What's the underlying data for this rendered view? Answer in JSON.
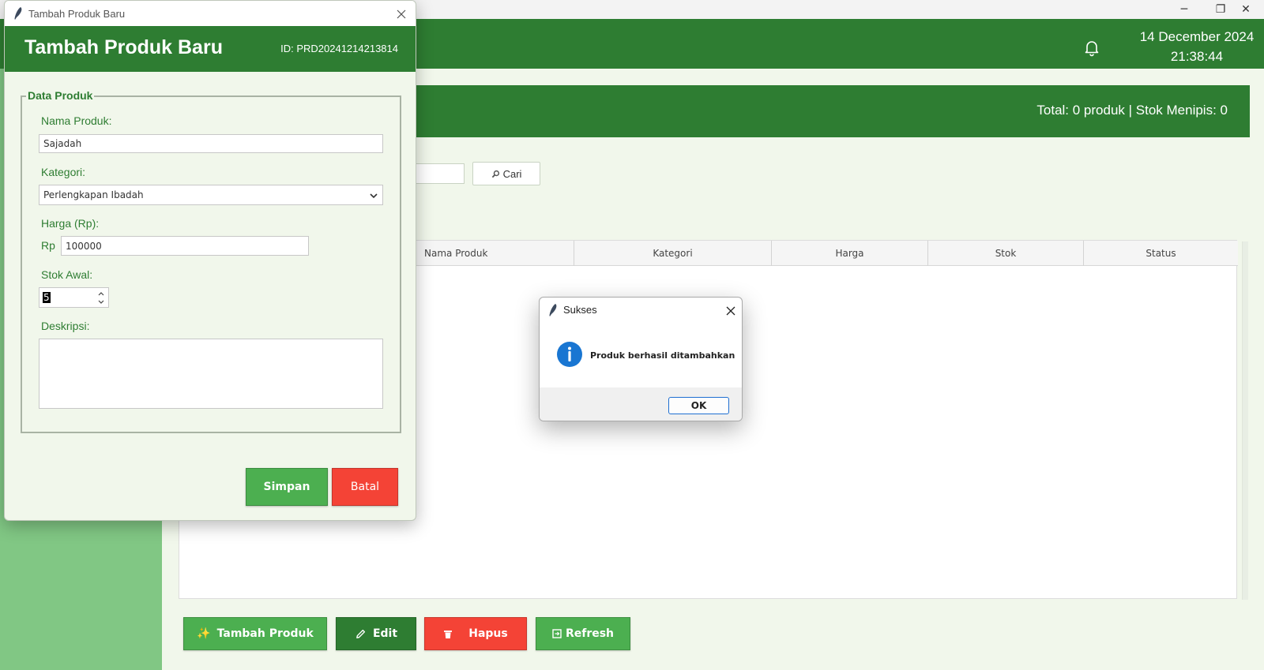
{
  "window": {
    "controls": {
      "minimize": "─",
      "restore": "❐",
      "close": "✕"
    }
  },
  "header": {
    "date": "14 December 2024",
    "time": "21:38:44"
  },
  "summary": {
    "text": "Total: 0 produk | Stok Menipis: 0"
  },
  "search": {
    "value": "",
    "button_label": "Cari"
  },
  "table": {
    "columns": [
      "Nama Produk",
      "Kategori",
      "Harga",
      "Stok",
      "Status"
    ],
    "rows": []
  },
  "actions": {
    "add_label": "Tambah Produk",
    "edit_label": "Edit",
    "delete_label": "Hapus",
    "refresh_label": "Refresh"
  },
  "form_dialog": {
    "window_title": "Tambah Produk Baru",
    "title": "Tambah Produk Baru",
    "id_text": "ID: PRD20241214213814",
    "group_label": "Data Produk",
    "name_label": "Nama Produk:",
    "name_value": "Sajadah",
    "category_label": "Kategori:",
    "category_value": "Perlengkapan Ibadah",
    "price_label": "Harga (Rp):",
    "price_prefix": "Rp",
    "price_value": "100000",
    "stock_label": "Stok Awal:",
    "stock_value": "5",
    "description_label": "Deskripsi:",
    "description_value": "",
    "save_label": "Simpan",
    "cancel_label": "Batal"
  },
  "message_box": {
    "title": "Sukses",
    "message": "Produk berhasil ditambahkan",
    "ok_label": "OK",
    "icon": "info-icon"
  },
  "colors": {
    "primary": "#2e7d32",
    "accent": "#4caf50",
    "danger": "#f44336",
    "sidebar": "#81c784",
    "background": "#f1f7eb"
  }
}
